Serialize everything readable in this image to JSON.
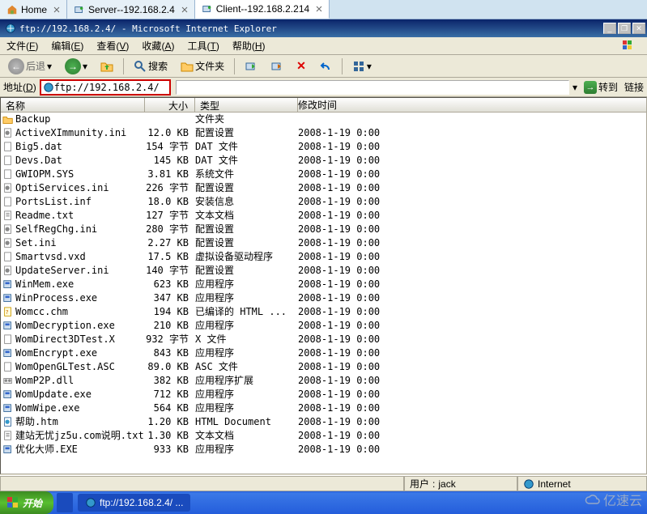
{
  "tabs_top": [
    {
      "label": "Home",
      "active": false
    },
    {
      "label": "Server--192.168.2.4",
      "active": false
    },
    {
      "label": "Client--192.168.2.214",
      "active": true
    }
  ],
  "window": {
    "title": "ftp://192.168.2.4/ - Microsoft Internet Explorer"
  },
  "menu": {
    "items": [
      {
        "label": "文件",
        "key": "F"
      },
      {
        "label": "编辑",
        "key": "E"
      },
      {
        "label": "查看",
        "key": "V"
      },
      {
        "label": "收藏",
        "key": "A"
      },
      {
        "label": "工具",
        "key": "T"
      },
      {
        "label": "帮助",
        "key": "H"
      }
    ]
  },
  "toolbar": {
    "back_label": "后退",
    "search_label": "搜索",
    "folders_label": "文件夹"
  },
  "address": {
    "label": "地址",
    "key": "D",
    "value": "ftp://192.168.2.4/",
    "go_label": "转到",
    "links_label": "链接"
  },
  "columns": {
    "name": "名称",
    "size": "大小",
    "type": "类型",
    "modified": "修改时间"
  },
  "files": [
    {
      "icon": "folder",
      "name": "Backup",
      "size": "",
      "type": "文件夹",
      "date": ""
    },
    {
      "icon": "ini",
      "name": "ActiveXImmunity.ini",
      "size": "12.0 KB",
      "type": "配置设置",
      "date": "2008-1-19 0:00"
    },
    {
      "icon": "dat",
      "name": "Big5.dat",
      "size": "154 字节",
      "type": "DAT 文件",
      "date": "2008-1-19 0:00"
    },
    {
      "icon": "dat",
      "name": "Devs.Dat",
      "size": "145 KB",
      "type": "DAT 文件",
      "date": "2008-1-19 0:00"
    },
    {
      "icon": "sys",
      "name": "GWIOPM.SYS",
      "size": "3.81 KB",
      "type": "系统文件",
      "date": "2008-1-19 0:00"
    },
    {
      "icon": "ini",
      "name": "OptiServices.ini",
      "size": "226 字节",
      "type": "配置设置",
      "date": "2008-1-19 0:00"
    },
    {
      "icon": "inf",
      "name": "PortsList.inf",
      "size": "18.0 KB",
      "type": "安装信息",
      "date": "2008-1-19 0:00"
    },
    {
      "icon": "txt",
      "name": "Readme.txt",
      "size": "127 字节",
      "type": "文本文档",
      "date": "2008-1-19 0:00"
    },
    {
      "icon": "ini",
      "name": "SelfRegChg.ini",
      "size": "280 字节",
      "type": "配置设置",
      "date": "2008-1-19 0:00"
    },
    {
      "icon": "ini",
      "name": "Set.ini",
      "size": "2.27 KB",
      "type": "配置设置",
      "date": "2008-1-19 0:00"
    },
    {
      "icon": "vxd",
      "name": "Smartvsd.vxd",
      "size": "17.5 KB",
      "type": "虚拟设备驱动程序",
      "date": "2008-1-19 0:00"
    },
    {
      "icon": "ini",
      "name": "UpdateServer.ini",
      "size": "140 字节",
      "type": "配置设置",
      "date": "2008-1-19 0:00"
    },
    {
      "icon": "exe",
      "name": "WinMem.exe",
      "size": "623 KB",
      "type": "应用程序",
      "date": "2008-1-19 0:00"
    },
    {
      "icon": "exe",
      "name": "WinProcess.exe",
      "size": "347 KB",
      "type": "应用程序",
      "date": "2008-1-19 0:00"
    },
    {
      "icon": "chm",
      "name": "Womcc.chm",
      "size": "194 KB",
      "type": "已编译的 HTML ...",
      "date": "2008-1-19 0:00"
    },
    {
      "icon": "exe",
      "name": "WomDecryption.exe",
      "size": "210 KB",
      "type": "应用程序",
      "date": "2008-1-19 0:00"
    },
    {
      "icon": "x",
      "name": "WomDirect3DTest.X",
      "size": "932 字节",
      "type": "X 文件",
      "date": "2008-1-19 0:00"
    },
    {
      "icon": "exe",
      "name": "WomEncrypt.exe",
      "size": "843 KB",
      "type": "应用程序",
      "date": "2008-1-19 0:00"
    },
    {
      "icon": "asc",
      "name": "WomOpenGLTest.ASC",
      "size": "89.0 KB",
      "type": "ASC 文件",
      "date": "2008-1-19 0:00"
    },
    {
      "icon": "dll",
      "name": "WomP2P.dll",
      "size": "382 KB",
      "type": "应用程序扩展",
      "date": "2008-1-19 0:00"
    },
    {
      "icon": "exe",
      "name": "WomUpdate.exe",
      "size": "712 KB",
      "type": "应用程序",
      "date": "2008-1-19 0:00"
    },
    {
      "icon": "exe",
      "name": "WomWipe.exe",
      "size": "564 KB",
      "type": "应用程序",
      "date": "2008-1-19 0:00"
    },
    {
      "icon": "htm",
      "name": "帮助.htm",
      "size": "1.20 KB",
      "type": "HTML Document",
      "date": "2008-1-19 0:00"
    },
    {
      "icon": "txt",
      "name": "建站无忧jz5u.com说明.txt",
      "size": "1.30 KB",
      "type": "文本文档",
      "date": "2008-1-19 0:00"
    },
    {
      "icon": "exe",
      "name": "优化大师.EXE",
      "size": "933 KB",
      "type": "应用程序",
      "date": "2008-1-19 0:00"
    }
  ],
  "status": {
    "user_label": "用户",
    "user_value": "jack",
    "zone_label": "Internet"
  },
  "taskbar": {
    "start_label": "开始",
    "task_label": "ftp://192.168.2.4/ ..."
  },
  "watermark": "亿速云"
}
